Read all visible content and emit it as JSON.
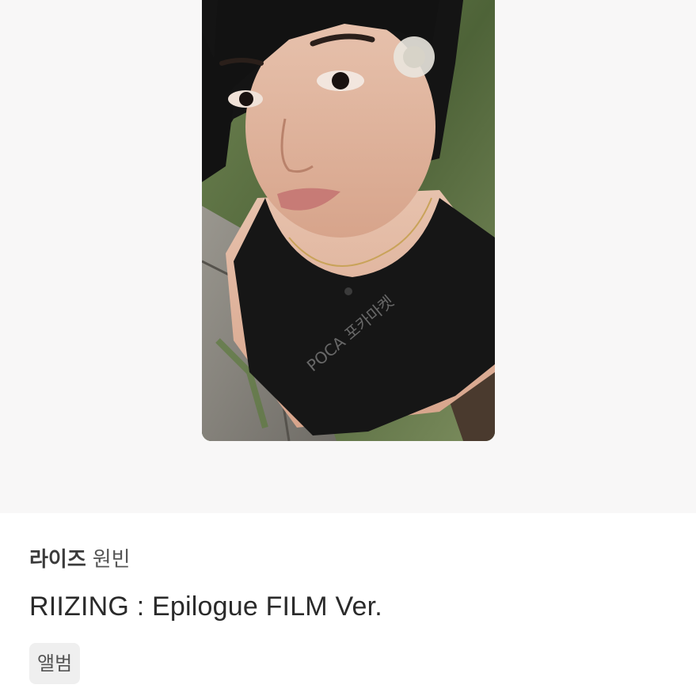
{
  "product": {
    "image": {
      "alt": "photocard",
      "watermark_text": "POCA 포카마켓"
    },
    "group": "라이즈",
    "member": "원빈",
    "album_title": "RIIZING : Epilogue FILM Ver.",
    "category_tag": "앨범"
  }
}
